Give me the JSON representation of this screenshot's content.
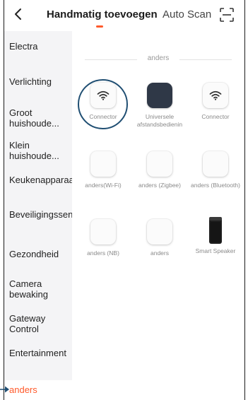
{
  "header": {
    "tabs": [
      {
        "label": "Handmatig toevoegen",
        "active": true
      },
      {
        "label": "Auto Scan",
        "active": false
      }
    ]
  },
  "sidebar": {
    "items": [
      {
        "label": "Electra"
      },
      {
        "label": "Verlichting"
      },
      {
        "label": "Groot huishoude..."
      },
      {
        "label": "Klein huishoude..."
      },
      {
        "label": "Keukenapparaat"
      },
      {
        "label": "Beveiligingssensor"
      },
      {
        "label": "Gezondheid"
      },
      {
        "label": "Camera bewaking"
      },
      {
        "label": "Gateway Control"
      },
      {
        "label": "Entertainment"
      },
      {
        "label": "anders",
        "active": true
      }
    ]
  },
  "main": {
    "section_title": "anders",
    "devices": [
      {
        "label": "Connector",
        "icon": "wifi-icon"
      },
      {
        "label": "Universele afstandsbedienin",
        "icon": "remote-icon"
      },
      {
        "label": "Connector",
        "icon": "wifi-icon"
      },
      {
        "label": "anders(Wi-Fi)",
        "icon": "blank-device-icon"
      },
      {
        "label": "anders (Zigbee)",
        "icon": "blank-device-icon"
      },
      {
        "label": "anders (Bluetooth)",
        "icon": "blank-device-icon"
      },
      {
        "label": "anders (NB)",
        "icon": "blank-device-icon"
      },
      {
        "label": "anders",
        "icon": "blank-device-icon"
      },
      {
        "label": "Smart Speaker",
        "icon": "speaker-icon"
      }
    ]
  },
  "colors": {
    "accent": "#ff5a2b",
    "highlight_ring": "#1f4e72",
    "sidebar_bg": "#f4f4f6"
  }
}
